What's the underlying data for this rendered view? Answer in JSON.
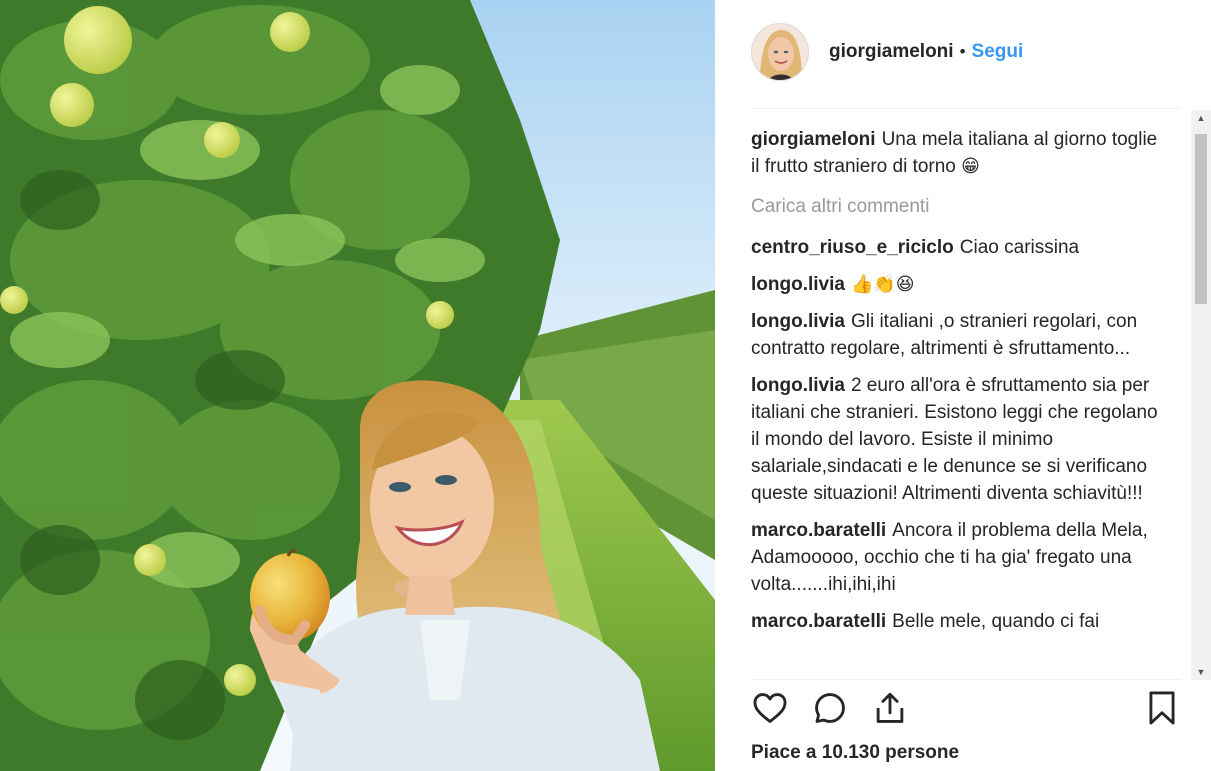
{
  "post": {
    "username": "giorgiameloni",
    "separator": "•",
    "follow_label": "Segui"
  },
  "caption": {
    "author": "giorgiameloni",
    "text": "Una mela italiana al giorno toglie il frutto straniero di torno",
    "emoji": "😁"
  },
  "load_more_label": "Carica altri commenti",
  "comments": [
    {
      "author": "centro_riuso_e_riciclo",
      "text": "Ciao carissina"
    },
    {
      "author": "longo.livia",
      "text": "👍👏😆"
    },
    {
      "author": "longo.livia",
      "text": "Gli italiani ,o stranieri regolari, con contratto regolare, altrimenti è sfruttamento..."
    },
    {
      "author": "longo.livia",
      "text": "2 euro all'ora è sfruttamento sia per italiani che stranieri. Esistono leggi che regolano il mondo del lavoro. Esiste il minimo salariale,sindacati e le denunce se si verificano queste situazioni! Altrimenti diventa schiavitù!!!"
    },
    {
      "author": "marco.baratelli",
      "text": "Ancora il problema della Mela, Adamooooo, occhio che ti ha gia' fregato una volta.......ihi,ihi,ihi"
    },
    {
      "author": "marco.baratelli",
      "text": "Belle mele, quando ci fai"
    }
  ],
  "likes_label": "Piace a 10.130 persone",
  "icons": {
    "like": "heart-icon",
    "comment": "comment-bubble-icon",
    "share": "share-icon",
    "save": "bookmark-icon"
  },
  "colors": {
    "link_blue": "#3897f0",
    "muted_gray": "#999999",
    "text": "#262626"
  }
}
